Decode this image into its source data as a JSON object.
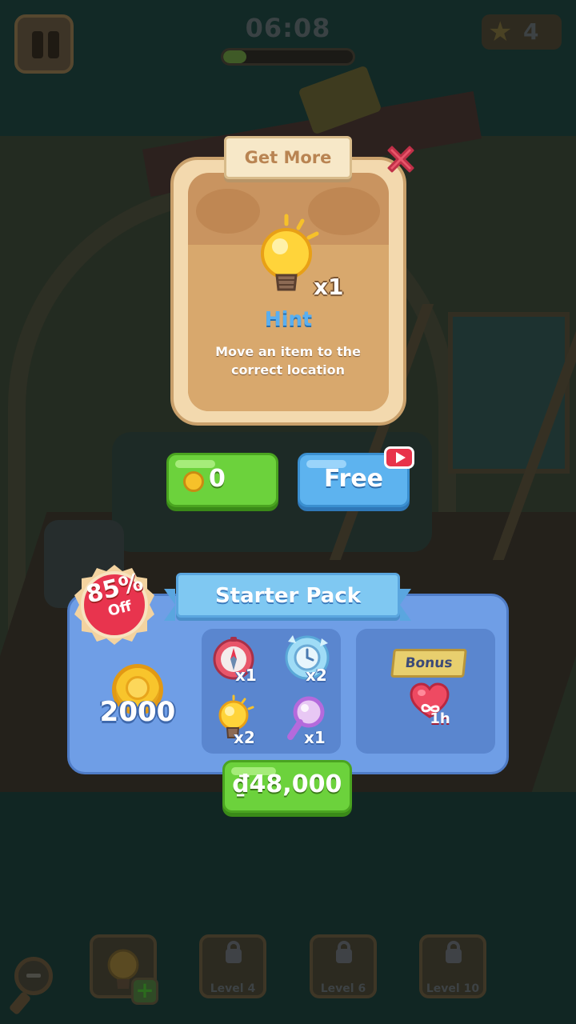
{
  "hud": {
    "timer": "06:08",
    "progress": 0.18,
    "stars": "4"
  },
  "dialog": {
    "title": "Get More",
    "item_qty": "x1",
    "item_name": "Hint",
    "item_desc": "Move an item to the correct location",
    "coin_price": "0",
    "free_label": "Free"
  },
  "starter_pack": {
    "title": "Starter Pack",
    "discount_percent": "85%",
    "discount_off": "Off",
    "coins": "2000",
    "items": [
      {
        "icon": "compass-icon",
        "qty": "x1"
      },
      {
        "icon": "frozen-clock-icon",
        "qty": "x2"
      },
      {
        "icon": "lightbulb-icon",
        "qty": "x2"
      },
      {
        "icon": "magnifier-icon",
        "qty": "x1"
      }
    ],
    "bonus_label": "Bonus",
    "bonus_duration": "1h",
    "price": "₫48,000"
  },
  "bottom_bar": {
    "slots": [
      {
        "label": "Level 4"
      },
      {
        "label": "Level 6"
      },
      {
        "label": "Level 10"
      }
    ]
  },
  "colors": {
    "green_button": "#6cd23c",
    "blue_button": "#5db3ef",
    "pack_blue": "#6f9ee6",
    "dialog_cream": "#f3d9ae",
    "close_red": "#e8334a"
  }
}
